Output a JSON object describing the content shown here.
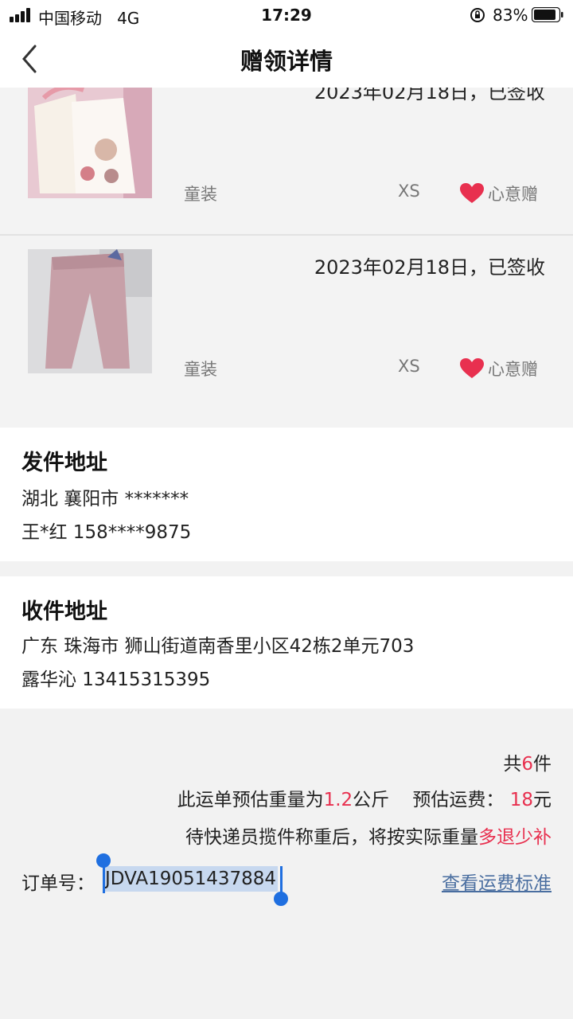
{
  "status_bar": {
    "carrier": "中国移动",
    "network": "4G",
    "time": "17:29",
    "battery_percent": "83%"
  },
  "nav": {
    "title": "赠领详情",
    "back_icon": "chevron-left-icon"
  },
  "items": [
    {
      "date_status": "2023年02月18日，已签收",
      "category": "童装",
      "size": "XS",
      "tag": "心意赠",
      "photo": "baby-clothes-set-photo"
    },
    {
      "date_status": "2023年02月18日，已签收",
      "category": "童装",
      "size": "XS",
      "tag": "心意赠",
      "photo": "pink-pants-photo"
    }
  ],
  "sender": {
    "title": "发件地址",
    "address": "湖北 襄阳市 *******",
    "contact": "王*红 158****9875"
  },
  "receiver": {
    "title": "收件地址",
    "address": "广东 珠海市 狮山街道南香里小区42栋2单元703",
    "contact": "露华沁 13415315395"
  },
  "summary": {
    "count_prefix": "共",
    "count": "6",
    "count_suffix": "件",
    "weight_prefix": "此运单预估重量为",
    "weight": "1.2",
    "weight_unit": "公斤",
    "fee_prefix": "预估运费：",
    "fee": "18",
    "fee_unit": "元",
    "note_prefix": "待快递员揽件称重后，将按实际重量",
    "note_highlight": "多退少补",
    "order_label": "订单号：",
    "order_number": "JDVA19051437884",
    "fee_standard_link": "查看运费标准"
  },
  "colors": {
    "accent_red": "#e8304f",
    "link_blue": "#4a6ea0",
    "selection_blue": "#1f6fe0"
  }
}
